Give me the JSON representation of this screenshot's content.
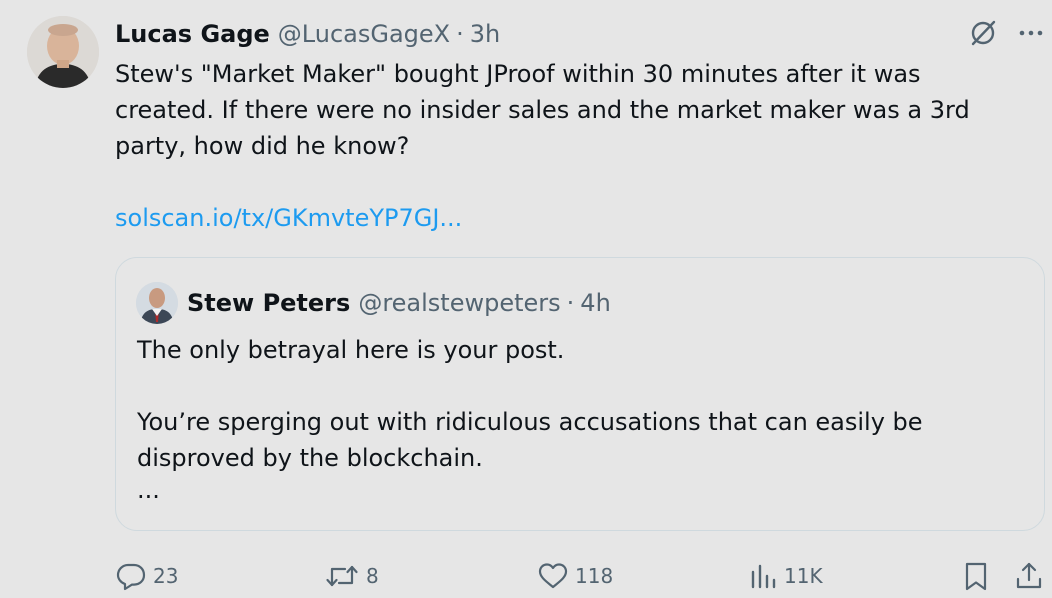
{
  "tweet": {
    "author_name": "Lucas Gage",
    "author_handle": "@LucasGageX",
    "separator": "·",
    "time": "3h",
    "text_lines": [
      "Stew's \"Market Maker\" bought JProof within 30 minutes after it was",
      "created. If there were no insider sales and the market maker was a 3rd",
      "party, how did he know?"
    ],
    "link": "solscan.io/tx/GKmvteYP7GJ..."
  },
  "quoted_tweet": {
    "author_name": "Stew Peters",
    "author_handle": "@realstewpeters",
    "separator": "·",
    "time": "4h",
    "paragraph1": "The only betrayal here is your post.",
    "paragraph2_lines": [
      "You’re sperging out with ridiculous accusations that can easily be",
      "disproved by the blockchain."
    ],
    "ellipsis": "..."
  },
  "actions": {
    "replies": "23",
    "reposts": "8",
    "likes": "118",
    "views": "11K"
  },
  "icons": {
    "grok": "grok-icon",
    "more": "more-options-icon",
    "reply": "reply-icon",
    "repost": "repost-icon",
    "like": "like-icon",
    "views": "views-icon",
    "bookmark": "bookmark-icon",
    "share": "share-icon"
  },
  "colors": {
    "background": "#e6e6e6",
    "text_primary": "#0f1419",
    "text_secondary": "#536471",
    "link": "#1d9bf0",
    "border": "#cfd9de"
  }
}
